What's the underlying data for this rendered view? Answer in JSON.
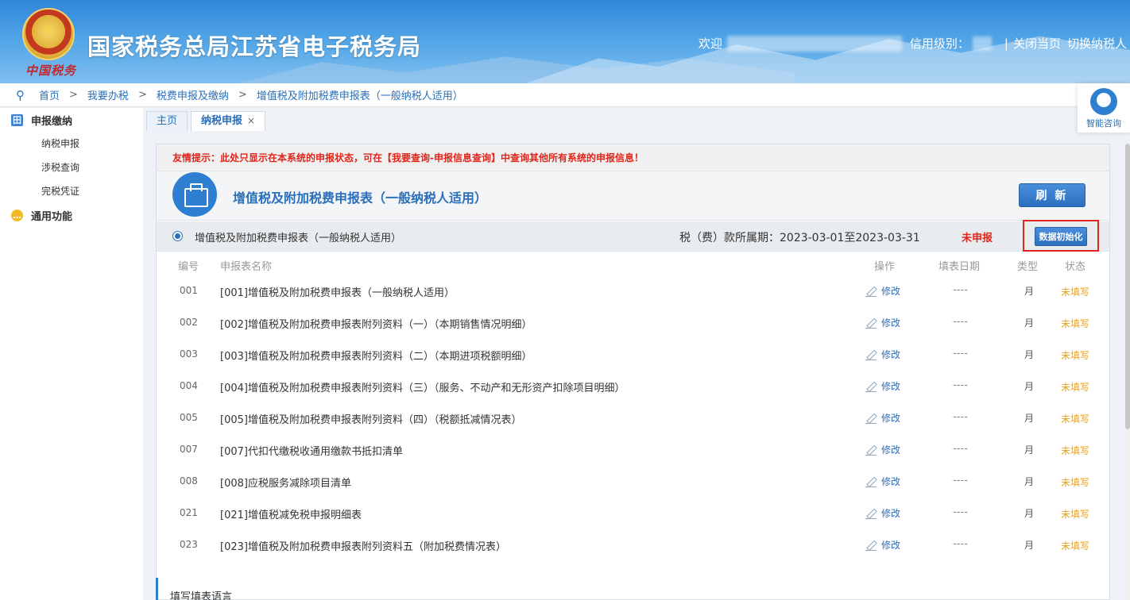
{
  "header": {
    "site_title": "国家税务总局江苏省电子税务局",
    "emblem_text": "中国税务",
    "welcome": "欢迎",
    "credit_label": "信用级别：",
    "close_page": "关闭当页",
    "switch_taxpayer": "切换纳税人",
    "separator": "|"
  },
  "breadcrumb": {
    "items": [
      "首页",
      "我要办税",
      "税费申报及缴纳",
      "增值税及附加税费申报表（一般纳税人适用）"
    ],
    "arrow": ">"
  },
  "help": {
    "label": "智能咨询"
  },
  "sidebar": {
    "groups": [
      {
        "label": "申报缴纳",
        "icon": "grid-icon",
        "items": [
          "纳税申报",
          "涉税查询",
          "完税凭证"
        ]
      },
      {
        "label": "通用功能",
        "icon": "chat-bubble-icon",
        "items": []
      }
    ]
  },
  "tabs": [
    {
      "label": "主页",
      "active": false
    },
    {
      "label": "纳税申报",
      "active": true,
      "close": "×"
    }
  ],
  "panel": {
    "notice": "友情提示：此处只显示在本系统的申报状态，可在【我要查询-申报信息查询】中查询其他所有系统的申报信息！",
    "form_title": "增值税及附加税费申报表（一般纳税人适用）",
    "refresh_label": "刷 新",
    "filing": {
      "name": "增值税及附加税费申报表（一般纳税人适用）",
      "period": "税（费）款所属期：2023-03-01至2023-03-31",
      "status": "未申报",
      "init_label": "数据初始化"
    },
    "columns": {
      "no": "编号",
      "name": "申报表名称",
      "op": "操作",
      "date": "填表日期",
      "type": "类型",
      "status": "状态"
    },
    "rows": [
      {
        "no": "001",
        "name": "[001]增值税及附加税费申报表（一般纳税人适用）",
        "op": "修改",
        "date": "----",
        "type": "月",
        "status": "未填写"
      },
      {
        "no": "002",
        "name": "[002]增值税及附加税费申报表附列资料（一）（本期销售情况明细）",
        "op": "修改",
        "date": "----",
        "type": "月",
        "status": "未填写"
      },
      {
        "no": "003",
        "name": "[003]增值税及附加税费申报表附列资料（二）（本期进项税额明细）",
        "op": "修改",
        "date": "----",
        "type": "月",
        "status": "未填写"
      },
      {
        "no": "004",
        "name": "[004]增值税及附加税费申报表附列资料（三）（服务、不动产和无形资产扣除项目明细）",
        "op": "修改",
        "date": "----",
        "type": "月",
        "status": "未填写"
      },
      {
        "no": "005",
        "name": "[005]增值税及附加税费申报表附列资料（四）（税额抵减情况表）",
        "op": "修改",
        "date": "----",
        "type": "月",
        "status": "未填写"
      },
      {
        "no": "007",
        "name": "[007]代扣代缴税收通用缴款书抵扣清单",
        "op": "修改",
        "date": "----",
        "type": "月",
        "status": "未填写"
      },
      {
        "no": "008",
        "name": "[008]应税服务减除项目清单",
        "op": "修改",
        "date": "----",
        "type": "月",
        "status": "未填写"
      },
      {
        "no": "021",
        "name": "[021]增值税减免税申报明细表",
        "op": "修改",
        "date": "----",
        "type": "月",
        "status": "未填写"
      },
      {
        "no": "023",
        "name": "[023]增值税及附加税费申报表附列资料五（附加税费情况表）",
        "op": "修改",
        "date": "----",
        "type": "月",
        "status": "未填写"
      }
    ],
    "bottom_text": "填写填表语言"
  },
  "colors": {
    "primary": "#2a6fb9",
    "alert": "#e0261c",
    "pending": "#e8a21a"
  }
}
